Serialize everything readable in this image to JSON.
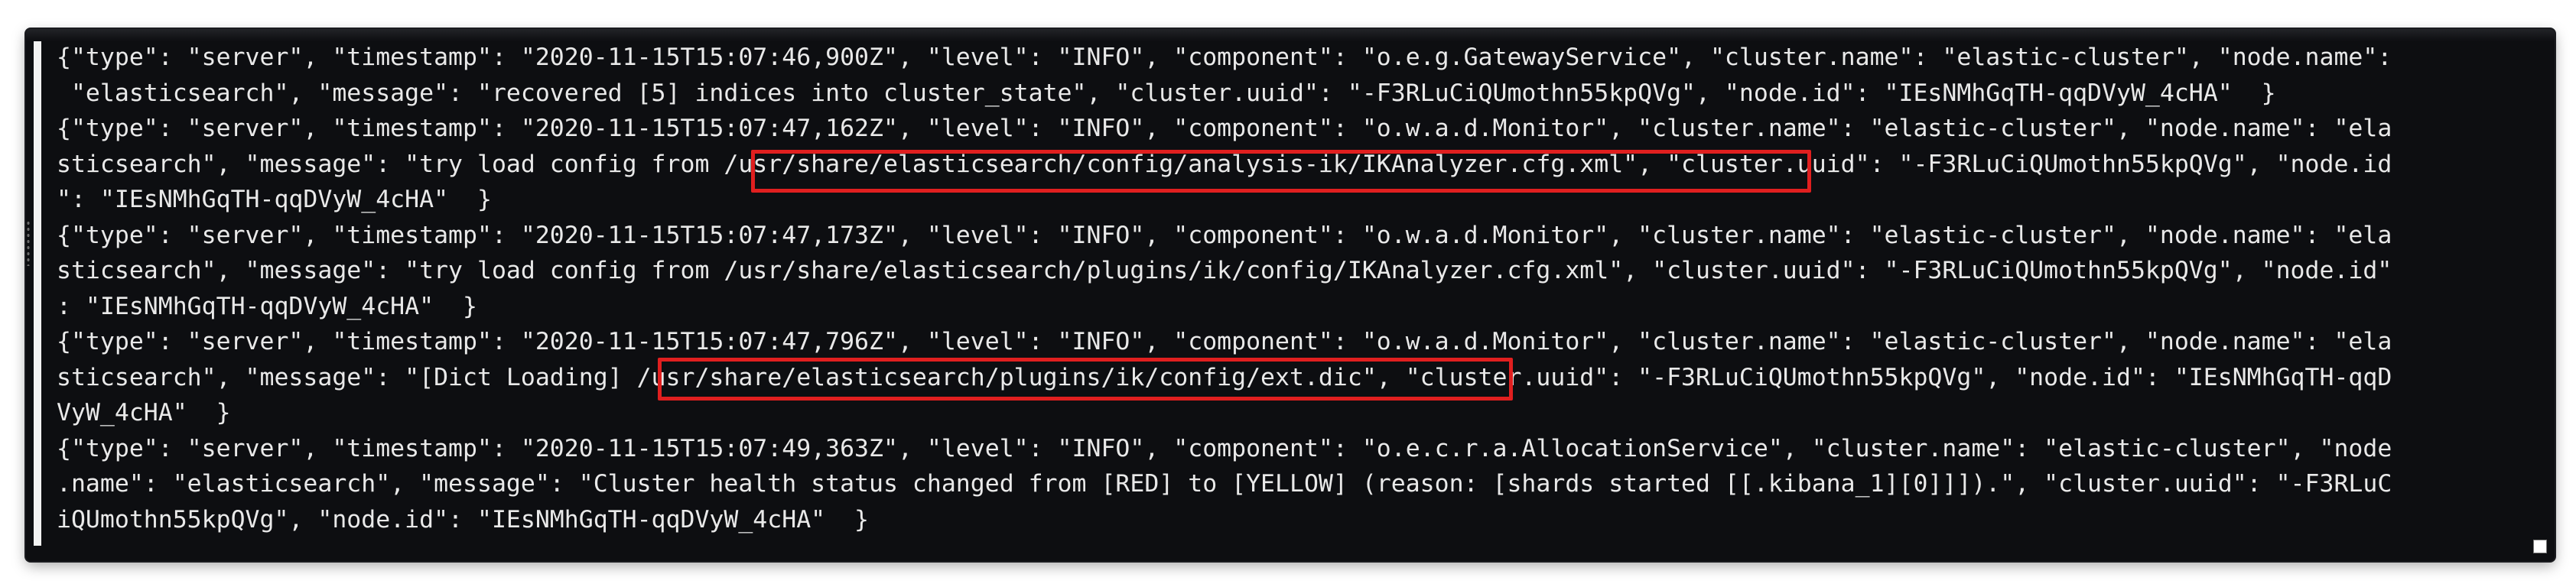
{
  "terminal": {
    "top_clipped_text": "\"  \"  ",
    "lines": [
      "{\"type\": \"server\", \"timestamp\": \"2020-11-15T15:07:46,900Z\", \"level\": \"INFO\", \"component\": \"o.e.g.GatewayService\", \"cluster.name\": \"elastic-cluster\", \"node.name\":",
      " \"elasticsearch\", \"message\": \"recovered [5] indices into cluster_state\", \"cluster.uuid\": \"-F3RLuCiQUmothn55kpQVg\", \"node.id\": \"IEsNMhGqTH-qqDVyW_4cHA\"  }",
      "{\"type\": \"server\", \"timestamp\": \"2020-11-15T15:07:47,162Z\", \"level\": \"INFO\", \"component\": \"o.w.a.d.Monitor\", \"cluster.name\": \"elastic-cluster\", \"node.name\": \"ela",
      "sticsearch\", \"message\": \"try load config from /usr/share/elasticsearch/config/analysis-ik/IKAnalyzer.cfg.xml\", \"cluster.uuid\": \"-F3RLuCiQUmothn55kpQVg\", \"node.id",
      "\": \"IEsNMhGqTH-qqDVyW_4cHA\"  }",
      "{\"type\": \"server\", \"timestamp\": \"2020-11-15T15:07:47,173Z\", \"level\": \"INFO\", \"component\": \"o.w.a.d.Monitor\", \"cluster.name\": \"elastic-cluster\", \"node.name\": \"ela",
      "sticsearch\", \"message\": \"try load config from /usr/share/elasticsearch/plugins/ik/config/IKAnalyzer.cfg.xml\", \"cluster.uuid\": \"-F3RLuCiQUmothn55kpQVg\", \"node.id\"",
      ": \"IEsNMhGqTH-qqDVyW_4cHA\"  }",
      "{\"type\": \"server\", \"timestamp\": \"2020-11-15T15:07:47,796Z\", \"level\": \"INFO\", \"component\": \"o.w.a.d.Monitor\", \"cluster.name\": \"elastic-cluster\", \"node.name\": \"ela",
      "sticsearch\", \"message\": \"[Dict Loading] /usr/share/elasticsearch/plugins/ik/config/ext.dic\", \"cluster.uuid\": \"-F3RLuCiQUmothn55kpQVg\", \"node.id\": \"IEsNMhGqTH-qqD",
      "VyW_4cHA\"  }",
      "{\"type\": \"server\", \"timestamp\": \"2020-11-15T15:07:49,363Z\", \"level\": \"INFO\", \"component\": \"o.e.c.r.a.AllocationService\", \"cluster.name\": \"elastic-cluster\", \"node",
      ".name\": \"elasticsearch\", \"message\": \"Cluster health status changed from [RED] to [YELLOW] (reason: [shards started [[.kibana_1][0]]]).\", \"cluster.uuid\": \"-F3RLuC",
      "iQUmothn55kpQVg\", \"node.id\": \"IEsNMhGqTH-qqDVyW_4cHA\"  }"
    ]
  },
  "highlight_color": "#e01f1f",
  "background_color": "#0d0e11",
  "text_color": "#e9e9e9"
}
